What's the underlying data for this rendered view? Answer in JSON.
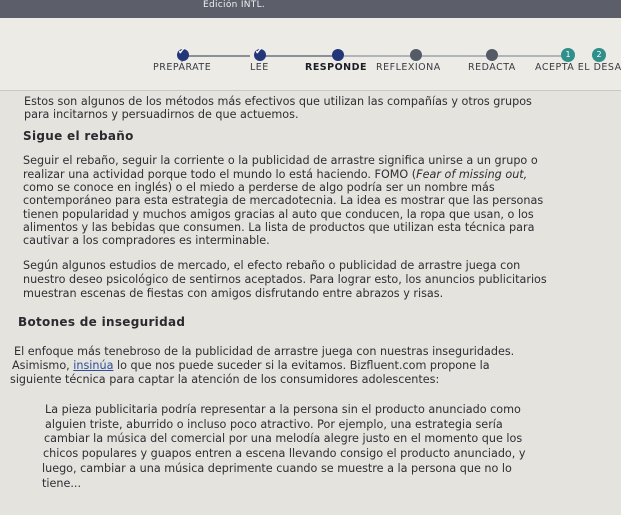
{
  "header": {
    "title": "Edición INTL."
  },
  "steps": [
    {
      "label": "PREPÁRATE",
      "state": "done"
    },
    {
      "label": "LEE",
      "state": "done"
    },
    {
      "label": "RESPONDE",
      "state": "current"
    },
    {
      "label": "REFLEXIONA",
      "state": "todo"
    },
    {
      "label": "REDACTA",
      "state": "todo"
    },
    {
      "label": "ACEPTA EL DESA",
      "state": "todo"
    }
  ],
  "sub_steps": [
    "1",
    "2"
  ],
  "colors": {
    "accent": "#23367a",
    "teal": "#2f8f8a"
  },
  "article": {
    "intro": [
      "Estos son algunos de los métodos más efectivos que utilizan las compañías y otros grupos",
      "para incitarnos y persuadirnos de que actuemos."
    ],
    "section1_title": "Sigue el rebaño",
    "section1_p1": [
      "Seguir el rebaño, seguir la corriente o la publicidad de arrastre significa unirse a un grupo o",
      "realizar una actividad porque todo el mundo lo está haciendo. FOMO (",
      "Fear of missing out,",
      "como se conoce en inglés) o el miedo a perderse de algo podría ser un nombre más",
      "contemporáneo para esta estrategia de mercadotecnia. La idea es mostrar que las personas",
      "tienen popularidad y muchos amigos gracias al auto que conducen, la ropa que usan, o los",
      "alimentos y las bebidas que consumen. La lista de productos que utilizan esta técnica para",
      "cautivar a los compradores es interminable."
    ],
    "section1_p2": [
      "Según algunos estudios de mercado, el efecto rebaño o publicidad de arrastre juega con",
      "nuestro deseo psicológico de sentirnos aceptados. Para lograr esto, los anuncios publicitarios",
      "muestran escenas de fiestas con amigos disfrutando entre abrazos y risas."
    ],
    "section2_title": "Botones de inseguridad",
    "section2_p1": [
      "El enfoque más tenebroso de la publicidad de arrastre juega con nuestras inseguridades.",
      "Asimismo, ",
      "insinúa",
      " lo que nos puede suceder si la evitamos. Bizfluent.com propone la",
      "siguiente técnica para captar la atención de los consumidores adolescentes:"
    ],
    "quote": [
      "La pieza publicitaria podría representar a la persona sin el producto anunciado como",
      "alguien triste, aburrido o incluso poco atractivo. Por ejemplo, una estrategia sería",
      "cambiar la música del comercial por una melodía alegre justo en el momento que los",
      "chicos populares y guapos entren a escena llevando consigo el producto anunciado, y",
      "luego, cambiar a una música deprimente cuando se muestre a la persona que no lo",
      "tiene..."
    ]
  }
}
